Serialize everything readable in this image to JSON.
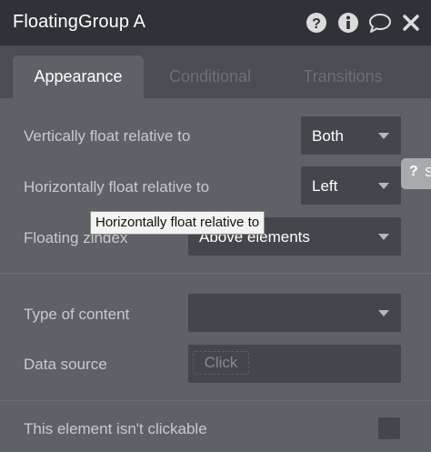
{
  "header": {
    "title": "FloatingGroup A",
    "icons": [
      "help-circle-icon",
      "info-circle-icon",
      "comment-icon",
      "close-icon"
    ]
  },
  "tabs": [
    {
      "label": "Appearance",
      "active": true
    },
    {
      "label": "Conditional",
      "active": false
    },
    {
      "label": "Transitions",
      "active": false
    }
  ],
  "fields": {
    "vertical_float": {
      "label": "Vertically float relative to",
      "value": "Both"
    },
    "horizontal_float": {
      "label": "Horizontally float relative to",
      "value": "Left"
    },
    "floating_zindex": {
      "label": "Floating zindex",
      "value": "Above elements"
    },
    "type_of_content": {
      "label": "Type of content",
      "value": ""
    },
    "data_source": {
      "label": "Data source",
      "button": "Click"
    },
    "not_clickable": {
      "label": "This element isn't clickable",
      "checked": false
    }
  },
  "tooltip": "Horizontally float relative to",
  "help_tab": {
    "q": "?",
    "text": "S"
  },
  "colors": {
    "header_bg": "#2f3236",
    "panel_bg": "#5e6266",
    "tabbar_bg": "#4a4e52",
    "input_bg": "#43474b"
  }
}
